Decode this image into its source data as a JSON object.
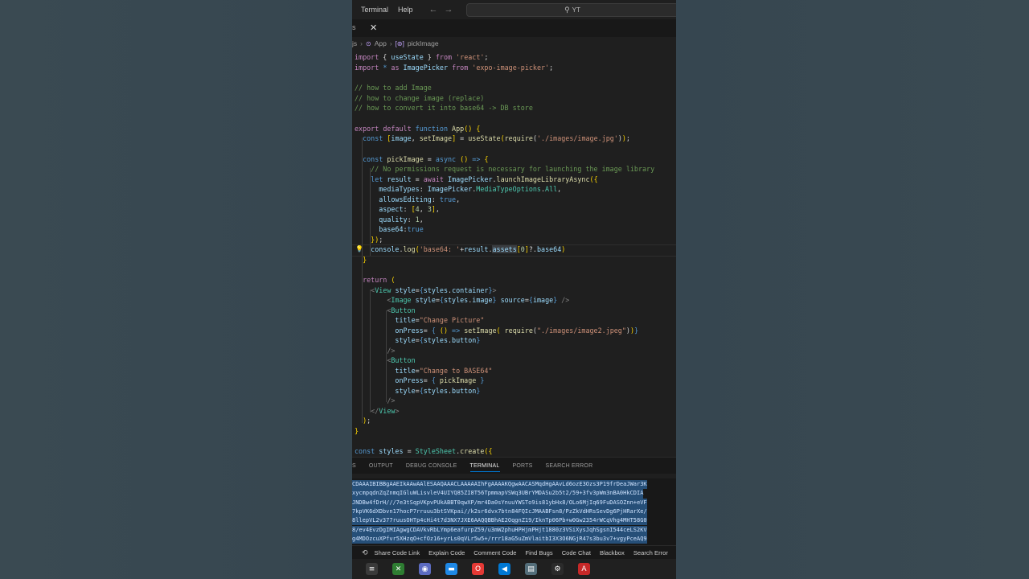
{
  "titlebar": {
    "menu": [
      "Terminal",
      "Help"
    ],
    "back_icon": "arrow-left-icon",
    "forward_icon": "arrow-right-icon",
    "search_placeholder": "YT"
  },
  "tabbar": {
    "fragment": "s",
    "close_icon": "close-icon"
  },
  "breadcrumb": {
    "file": "js",
    "component": "App",
    "symbol_icon": "variable-icon",
    "symbol": "pickImage"
  },
  "panel": {
    "tabs": [
      "S",
      "OUTPUT",
      "DEBUG CONSOLE",
      "TERMINAL",
      "PORTS",
      "SEARCH ERROR"
    ],
    "active_tab": "TERMINAL"
  },
  "terminal_lines": [
    "CDAAAIBIBBgAAEIkAAwAAlESAAQAAACLAAAAAIhFgAAAAKQgwAACASMqdHgAAvLd6ozE3Ozs3P19frDeaJWar3K",
    "xycmpqdnZqZnmqIGluWLisvleV4UIYQ85ZI8T56TpmmapVSWq3UBrYMDASu2b5t2/59+3fv3pWm3nBA0HkCDIA",
    "JNDBw4fDrH///7e3tSqpVKpvPUkABBT0qwXP/mr4Da0sYnuuYWSTo9is81ybHx8/OLo6MjIq69FuDASOZnn+eVF",
    "7kpVK6dXDbvn17hocP7rruuu3btSVKpai//k2sr6dvx7btn84FQIcJMAABFsn8/PzZkVdHRsSevDg6PjHRarXe/",
    "8llepVL2v377ruusOHTp4cHi4t7d3NX7JXE6AAQQBBhAE2OqgnZ19/IknTp06Pb+w0Gw2354rWCqVhg4MHT58G0",
    "8/ev4EvzDgIMIAgwgCDAVkvRbLYmp6eafurpZ59/u3mW2phuHPHjmPHjt1880z3VSiXysJqhSgsnI544ceLS2KV",
    "g4MDOzcuXPfvr5XHzqO+cfOz16+yrLs0qVLr5w5+/rrr18aG5uZmVlaitbI3X3O6NGjR47s3bu3v7+vgyPceAQ9"
  ],
  "statusbar": {
    "sync_icon": "sync-icon",
    "items": [
      "Share Code Link",
      "Explain Code",
      "Comment Code",
      "Find Bugs",
      "Code Chat",
      "Blackbox",
      "Search Error"
    ]
  },
  "taskbar": {
    "apps": [
      {
        "name": "app-switcher-icon",
        "color": "#3a3a3a",
        "glyph": "≡"
      },
      {
        "name": "xbox-icon",
        "color": "#2e7d32",
        "glyph": "✕"
      },
      {
        "name": "browser-icon",
        "color": "#5c6bc0",
        "glyph": "◉"
      },
      {
        "name": "file-explorer-icon",
        "color": "#1e88e5",
        "glyph": "▬"
      },
      {
        "name": "opera-icon",
        "color": "#e53935",
        "glyph": "O"
      },
      {
        "name": "vscode-icon",
        "color": "#0078d4",
        "glyph": "◀"
      },
      {
        "name": "terminal-icon",
        "color": "#546e7a",
        "glyph": "▤"
      },
      {
        "name": "settings-icon",
        "color": "#2b2b2b",
        "glyph": "⚙"
      },
      {
        "name": "pdf-reader-icon",
        "color": "#c62828",
        "glyph": "A"
      }
    ]
  }
}
